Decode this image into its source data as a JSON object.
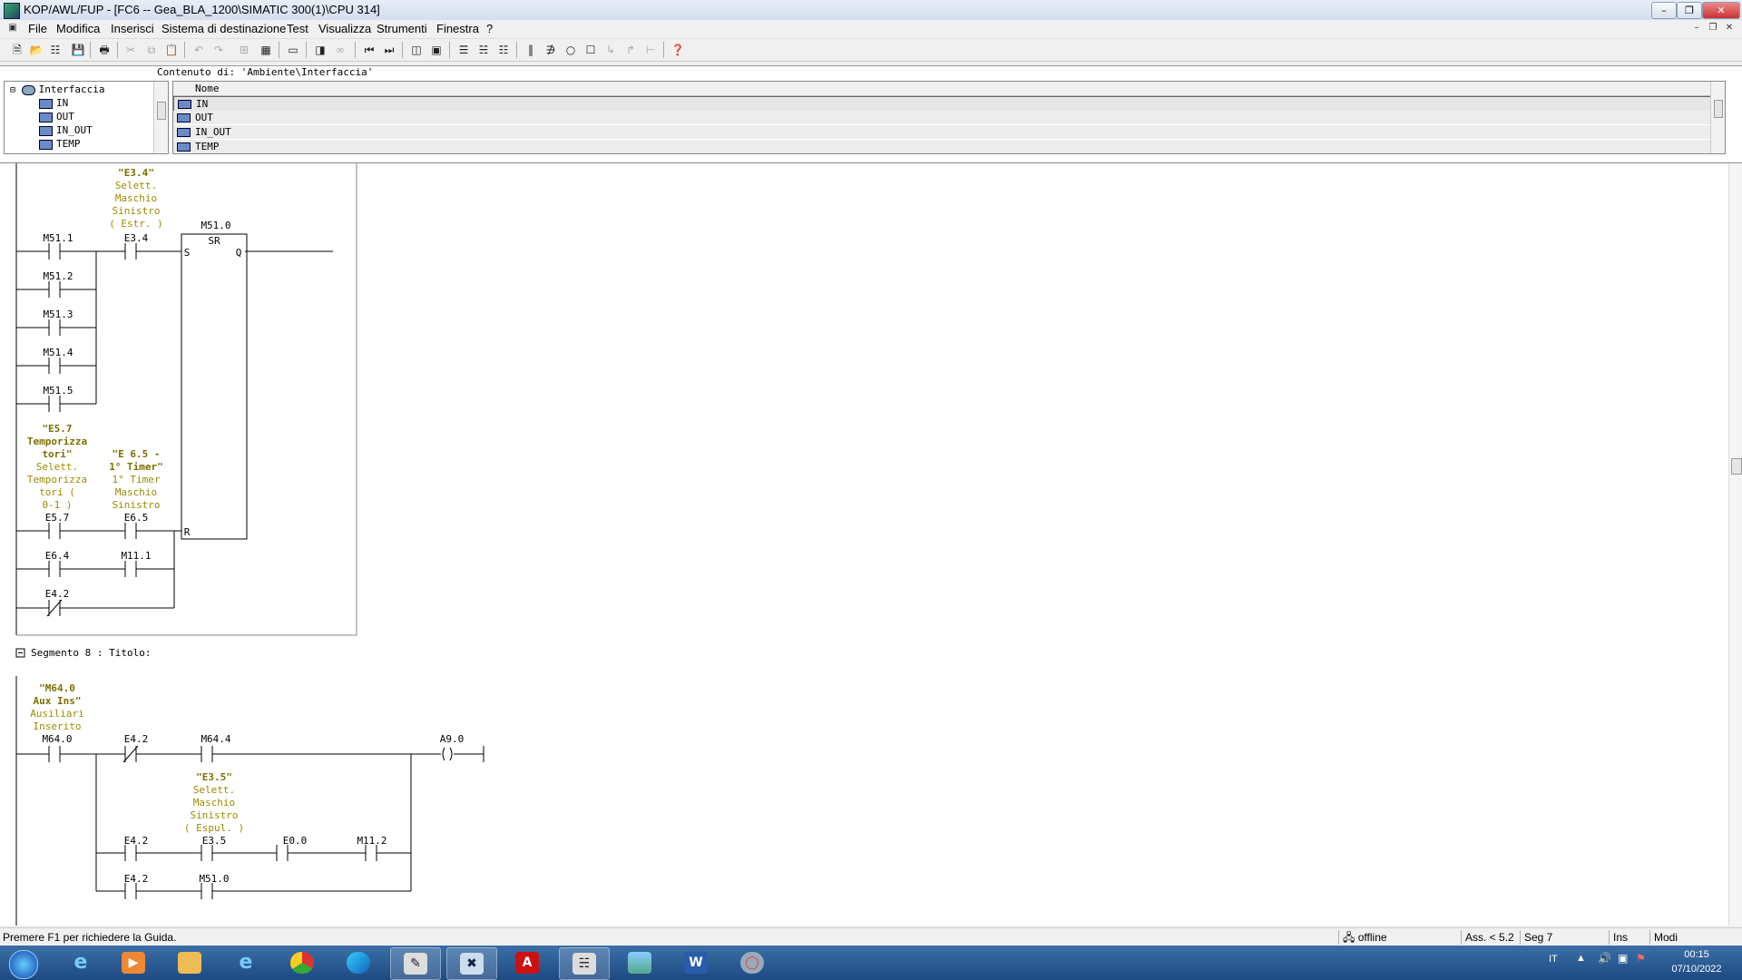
{
  "window": {
    "title": "KOP/AWL/FUP  - [FC6 -- Gea_BLA_1200\\SIMATIC 300(1)\\CPU 314]"
  },
  "menu": [
    "File",
    "Modifica",
    "Inserisci",
    "Sistema di destinazione",
    "Test",
    "Visualizza",
    "Strumenti",
    "Finestra",
    "?"
  ],
  "interface": {
    "content_header": "Contenuto di: 'Ambiente\\Interfaccia'",
    "tree_root": "Interfaccia",
    "tree_items": [
      "IN",
      "OUT",
      "IN_OUT",
      "TEMP"
    ],
    "column_header": "Nome",
    "rows": [
      "IN",
      "OUT",
      "IN_OUT",
      "TEMP"
    ]
  },
  "network7": {
    "sym_e34": "\"E3.4\"",
    "cmt_e34": [
      "Selett.",
      "Maschio",
      "Sinistro",
      "( Estr. )"
    ],
    "addr_m511": "M51.1",
    "addr_e34": "E3.4",
    "box_addr": "M51.0",
    "box_type": "SR",
    "pin_s": "S",
    "pin_q": "Q",
    "pin_r": "R",
    "parallel": [
      "M51.2",
      "M51.3",
      "M51.4",
      "M51.5"
    ],
    "sym_e57": [
      "\"E5.7",
      "Temporizza",
      "tori\""
    ],
    "cmt_e57": [
      "Selett.",
      "Temporizza",
      "tori (",
      "0-1 )"
    ],
    "sym_e65": [
      "\"E 6.5 -",
      "1° Timer\""
    ],
    "cmt_e65": [
      "1° Timer",
      "Maschio",
      "Sinistro"
    ],
    "addr_e57": "E5.7",
    "addr_e65": "E6.5",
    "addr_e64": "E6.4",
    "addr_m111": "M11.1",
    "addr_e42": "E4.2"
  },
  "network8": {
    "title": "Segmento 8 : Titolo:",
    "sym_m640": [
      "\"M64.0",
      "Aux Ins\""
    ],
    "cmt_m640": [
      "Ausiliari",
      "Inserito"
    ],
    "addr_m640": "M64.0",
    "addr_e42a": "E4.2",
    "addr_m644": "M64.4",
    "coil": "A9.0",
    "sym_e35": "\"E3.5\"",
    "cmt_e35": [
      "Selett.",
      "Maschio",
      "Sinistro",
      "( Espul. )"
    ],
    "addr_e42b": "E4.2",
    "addr_e35": "E3.5",
    "addr_e00": "E0.0",
    "addr_m112": "M11.2",
    "addr_e42c": "E4.2",
    "addr_m510": "M51.0"
  },
  "status": {
    "help": "Premere F1 per richiedere la Guida.",
    "mode": "offline",
    "ass": "Ass. < 5.2",
    "seg": "Seg 7",
    "ins": "Ins",
    "modi": "Modi"
  },
  "tray": {
    "lang": "IT",
    "time": "00:15",
    "date": "07/10/2022"
  },
  "colors": {
    "symbol": "#7a7000",
    "comment": "#9a8c00",
    "wire": "#000000"
  }
}
